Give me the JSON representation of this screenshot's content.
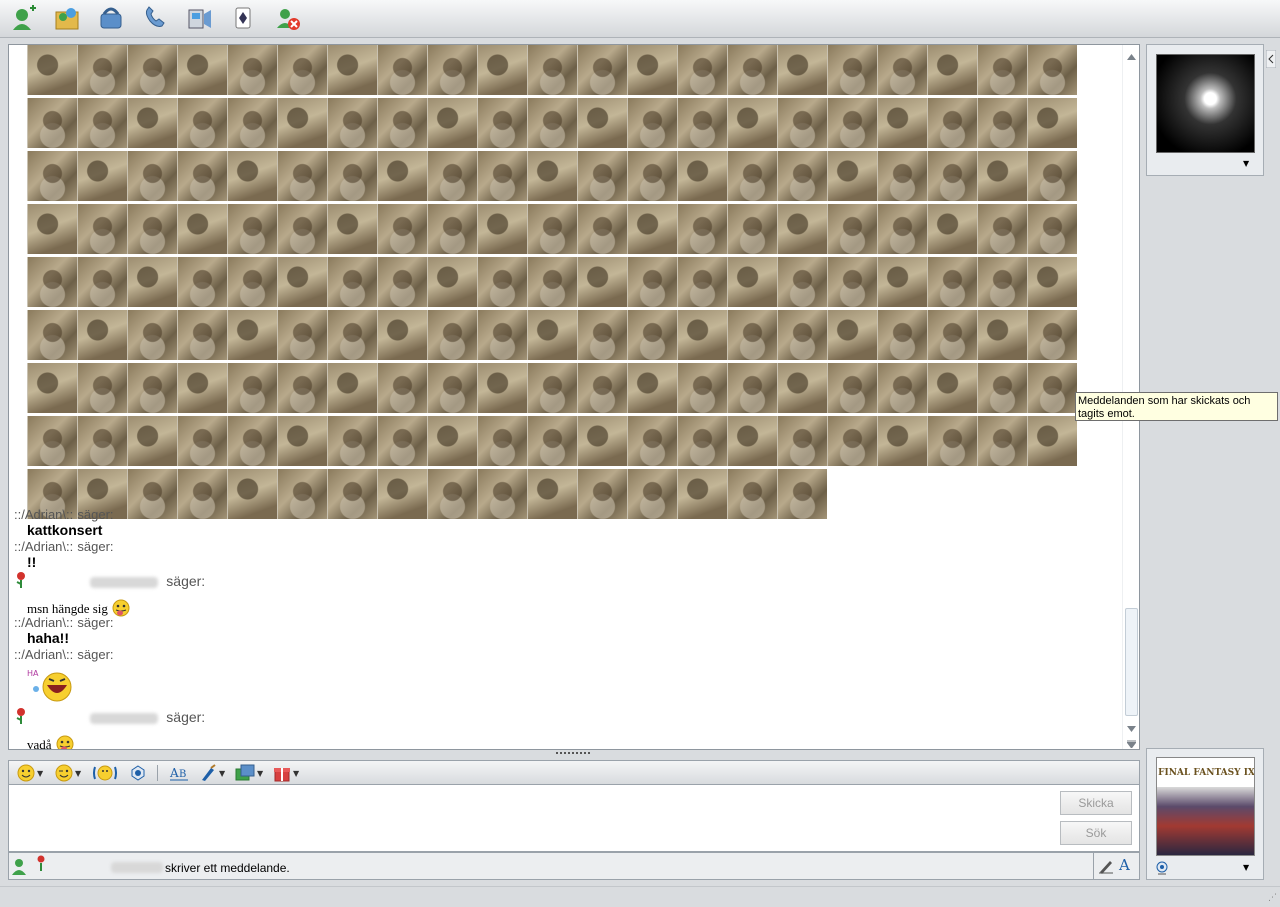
{
  "toolbar": {
    "icons": [
      "add-contact-icon",
      "share-files-icon",
      "phone-icon",
      "call-icon",
      "video-icon",
      "games-icon",
      "block-icon"
    ]
  },
  "conversation": {
    "messages": [
      {
        "sender": "::/Adrian\\::",
        "verb": "säger:",
        "text": "kattkonsert"
      },
      {
        "sender": "::/Adrian\\::",
        "verb": "säger:",
        "text": "!!"
      },
      {
        "sender": "",
        "verb": "säger:",
        "text": "msn hängde sig"
      },
      {
        "sender": "::/Adrian\\::",
        "verb": "säger:",
        "text": "haha!!"
      },
      {
        "sender": "::/Adrian\\::",
        "verb": "säger:",
        "text": ""
      },
      {
        "sender": "",
        "verb": "säger:",
        "text": "vadå"
      }
    ]
  },
  "tooltip": {
    "text": "Meddelanden som har skickats och tagits emot."
  },
  "formatting": {
    "icons": [
      "emoticon-icon",
      "wink-icon",
      "nudge-icon",
      "voice-clip-icon",
      "font-icon",
      "background-icon",
      "share-icon",
      "gift-icon"
    ]
  },
  "input": {
    "send_label": "Skicka",
    "search_label": "Sök"
  },
  "status": {
    "text": "skriver ett meddelande."
  },
  "contact_picture": {
    "title": "FINAL FANTASY IX"
  },
  "colors": {
    "accent": "#2b6cb0",
    "tooltip_bg": "#ffffe1"
  }
}
